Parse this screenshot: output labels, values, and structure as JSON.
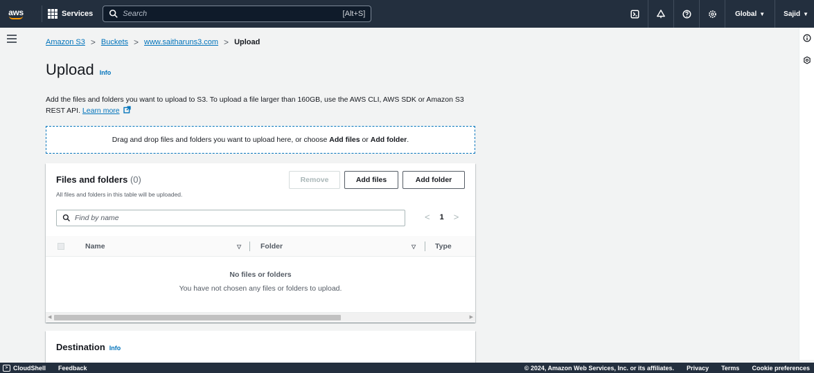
{
  "topnav": {
    "logo_text": "aws",
    "services_label": "Services",
    "search_placeholder": "Search",
    "search_shortcut": "[Alt+S]",
    "region_label": "Global",
    "user_label": "Sajid"
  },
  "breadcrumb": {
    "items": [
      "Amazon S3",
      "Buckets",
      "www.saitharuns3.com"
    ],
    "current": "Upload"
  },
  "page": {
    "title": "Upload",
    "info_label": "Info",
    "description": "Add the files and folders you want to upload to S3. To upload a file larger than 160GB, use the AWS CLI, AWS SDK or Amazon S3 REST API.",
    "learn_more": "Learn more"
  },
  "dropzone": {
    "text_before": "Drag and drop files and folders you want to upload here, or choose ",
    "add_files": "Add files",
    "or": " or ",
    "add_folder": "Add folder",
    "period": "."
  },
  "files_panel": {
    "title": "Files and folders",
    "count": "(0)",
    "subtitle": "All files and folders in this table will be uploaded.",
    "remove_label": "Remove",
    "add_files_label": "Add files",
    "add_folder_label": "Add folder",
    "filter_placeholder": "Find by name",
    "page_number": "1",
    "columns": [
      "Name",
      "Folder",
      "Type"
    ],
    "empty_title": "No files or folders",
    "empty_subtitle": "You have not chosen any files or folders to upload."
  },
  "destination": {
    "title": "Destination",
    "info_label": "Info"
  },
  "footer": {
    "cloudshell": "CloudShell",
    "feedback": "Feedback",
    "copyright": "© 2024, Amazon Web Services, Inc. or its affiliates.",
    "privacy": "Privacy",
    "terms": "Terms",
    "cookie": "Cookie preferences"
  }
}
